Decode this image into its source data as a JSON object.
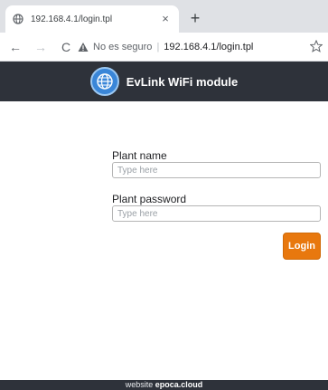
{
  "browser": {
    "tab_title": "192.168.4.1/login.tpl",
    "tab_close": "×",
    "new_tab": "+",
    "back": "←",
    "forward": "→",
    "reload": "C",
    "security_label": "No es seguro",
    "separator": "|",
    "url": "192.168.4.1/login.tpl"
  },
  "header": {
    "title": "EvLink WiFi module",
    "accent_color": "#3a86d8",
    "bar_color": "#2e323a"
  },
  "form": {
    "plant_name_label": "Plant name",
    "plant_name_placeholder": "Type here",
    "plant_name_value": "",
    "plant_password_label": "Plant password",
    "plant_password_placeholder": "Type here",
    "plant_password_value": "",
    "login_label": "Login",
    "login_color": "#e8780e"
  },
  "footer": {
    "prefix": "website",
    "link": "epoca.cloud"
  }
}
